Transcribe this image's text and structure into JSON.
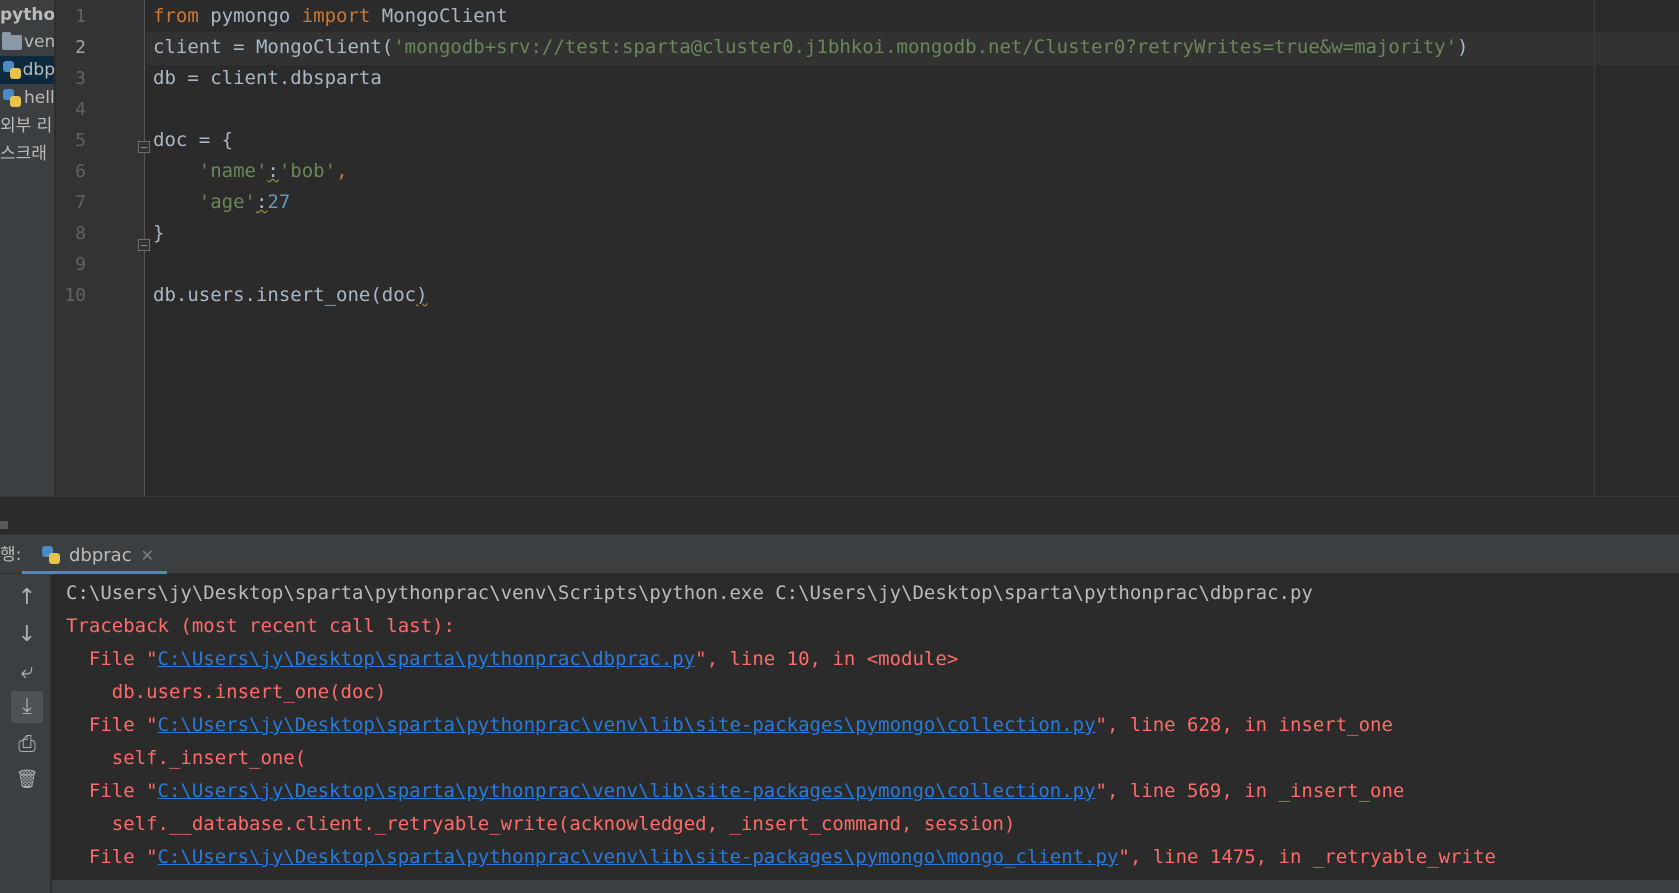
{
  "project": {
    "items": [
      {
        "label": "python",
        "icon": "project-root",
        "top": 0
      },
      {
        "label": "ven",
        "icon": "folder-icon"
      },
      {
        "label": "dbp",
        "icon": "python-file-icon",
        "selected": true
      },
      {
        "label": "hell",
        "icon": "python-file-icon"
      },
      {
        "label": "외부 리"
      },
      {
        "label": "스크래"
      }
    ]
  },
  "editor": {
    "line_numbers": [
      "1",
      "2",
      "3",
      "4",
      "5",
      "6",
      "7",
      "8",
      "9",
      "10"
    ],
    "current_line": "2",
    "code": {
      "l1_kw1": "from",
      "l1_mod": " pymongo ",
      "l1_kw2": "import",
      "l1_cls": " MongoClient",
      "l2_pre": "client = MongoClient(",
      "l2_str": "'mongodb+srv://test:sparta@cluster0.j1bhkoi.mongodb.net/Cluster0?retryWrites=true&w=majority'",
      "l2_post": ")",
      "l3": "db = client.dbsparta",
      "l5": "doc = {",
      "l6_key": "'name'",
      "l6_colon": ":",
      "l6_val": "'bob'",
      "l6_comma": ",",
      "l7_key": "'age'",
      "l7_colon": ":",
      "l7_val": "27",
      "l8": "}",
      "l10_pre": "db.users.insert_one(doc",
      "l10_post": ")"
    }
  },
  "run": {
    "title": "행:",
    "tab_label": "dbprac",
    "tab_close": "✕",
    "toolbar": {
      "up": "↑",
      "down": "↓",
      "wrap": "⤶",
      "scroll_end": "⤓",
      "print": "⎙",
      "clear": "🗑"
    }
  },
  "console": {
    "cmd": "C:\\Users\\jy\\Desktop\\sparta\\pythonprac\\venv\\Scripts\\python.exe C:\\Users\\jy\\Desktop\\sparta\\pythonprac\\dbprac.py",
    "traceback": "Traceback (most recent call last):",
    "f1_pre": "  File \"",
    "f1_link": "C:\\Users\\jy\\Desktop\\sparta\\pythonprac\\dbprac.py",
    "f1_post": "\", line 10, in <module>",
    "c1": "    db.users.insert_one(doc)",
    "f2_pre": "  File \"",
    "f2_link": "C:\\Users\\jy\\Desktop\\sparta\\pythonprac\\venv\\lib\\site-packages\\pymongo\\collection.py",
    "f2_post": "\", line 628, in insert_one",
    "c2": "    self._insert_one(",
    "f3_pre": "  File \"",
    "f3_link": "C:\\Users\\jy\\Desktop\\sparta\\pythonprac\\venv\\lib\\site-packages\\pymongo\\collection.py",
    "f3_post": "\", line 569, in _insert_one",
    "c3": "    self.__database.client._retryable_write(acknowledged, _insert_command, session)",
    "f4_pre": "  File \"",
    "f4_link": "C:\\Users\\jy\\Desktop\\sparta\\pythonprac\\venv\\lib\\site-packages\\pymongo\\mongo_client.py",
    "f4_post": "\", line 1475, in _retryable_write"
  },
  "colors": {
    "keyword": "#cc7832",
    "string": "#6a8759",
    "error": "#ff6b68",
    "link": "#287bde",
    "accent": "#4a88c7"
  }
}
